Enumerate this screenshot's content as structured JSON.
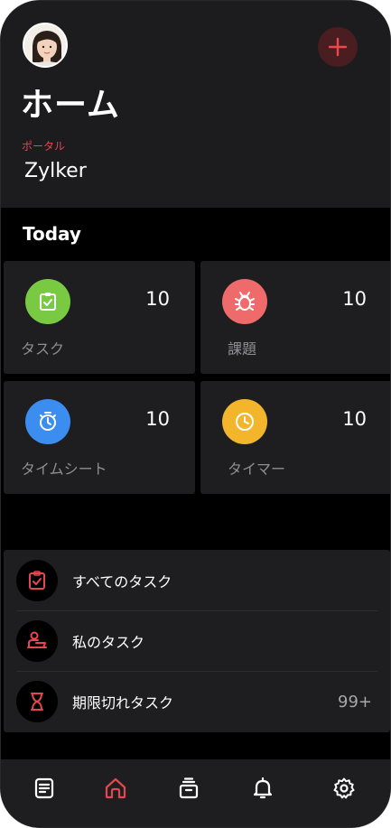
{
  "header": {
    "title": "ホーム",
    "portal_label": "ポータル",
    "portal_name": "Zylker",
    "add_icon": "plus-icon"
  },
  "today": {
    "label": "Today",
    "cards": [
      {
        "label": "タスク",
        "count": "10",
        "icon": "clipboard-check-icon",
        "color": "#7ac943"
      },
      {
        "label": "課題",
        "count": "10",
        "icon": "bug-icon",
        "color": "#ef6a6a"
      },
      {
        "label": "タイムシート",
        "count": "10",
        "icon": "stopwatch-icon",
        "color": "#3c8df0"
      },
      {
        "label": "タイマー",
        "count": "10",
        "icon": "clock-icon",
        "color": "#f3b52b"
      }
    ]
  },
  "list": {
    "items": [
      {
        "label": "すべてのタスク",
        "icon": "clipboard-check-icon",
        "count": ""
      },
      {
        "label": "私のタスク",
        "icon": "person-desk-icon",
        "count": ""
      },
      {
        "label": "期限切れタスク",
        "icon": "hourglass-icon",
        "count": "99+"
      }
    ]
  },
  "bottom_nav": {
    "items": [
      {
        "icon": "document-icon",
        "active": false
      },
      {
        "icon": "home-icon",
        "active": true
      },
      {
        "icon": "projects-icon",
        "active": false
      },
      {
        "icon": "bell-icon",
        "active": false
      },
      {
        "icon": "settings-icon",
        "active": false
      }
    ]
  },
  "colors": {
    "accent": "#e5474e",
    "background": "#000000",
    "surface": "#1e1e20"
  }
}
